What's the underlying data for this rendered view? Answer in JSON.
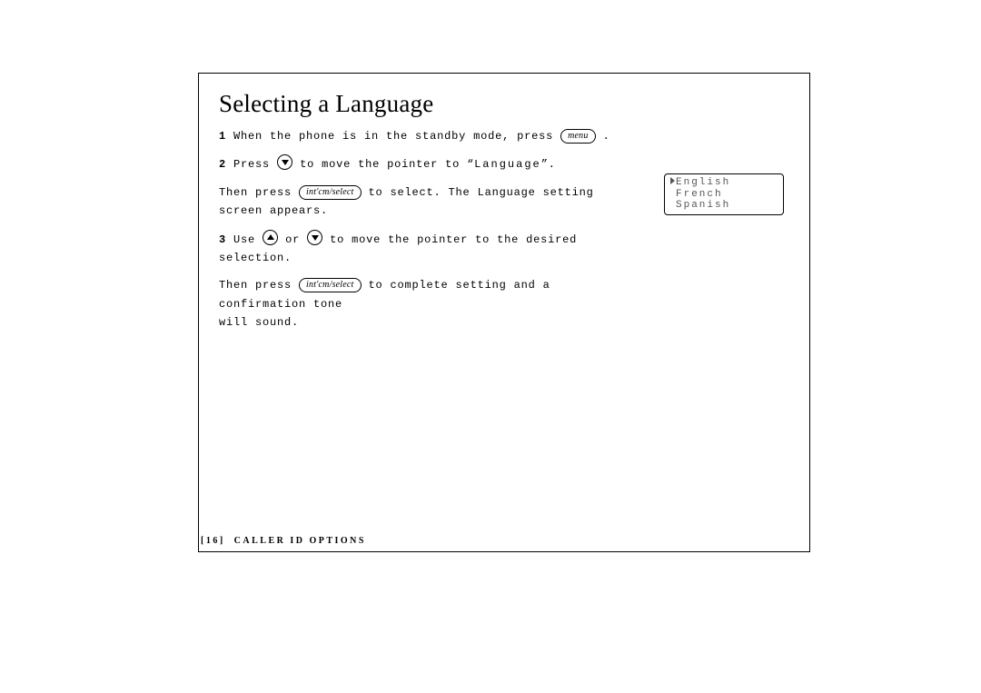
{
  "title": "Selecting a Language",
  "keys": {
    "menu": "menu",
    "select": "int'cm/select"
  },
  "steps": {
    "s1": {
      "num": "1",
      "pre": "When the phone is in the standby mode, press",
      "post": "."
    },
    "s2": {
      "num": "2",
      "pre": "Press",
      "mid": "to move the pointer to “",
      "lcdword": "Language",
      "post": "”."
    },
    "s2b": {
      "pre": "Then press",
      "mid": "to select. The Language setting",
      "post": "screen appears."
    },
    "s3": {
      "num": "3",
      "pre": "Use",
      "mid1": "or",
      "mid2": "to move the pointer to the desired selection."
    },
    "s3b": {
      "pre": "Then press",
      "mid": "to complete setting and a confirmation tone",
      "post": "will sound."
    }
  },
  "lcd": {
    "rows": [
      "English",
      "French",
      "Spanish"
    ]
  },
  "footer": {
    "page": "[16]",
    "section": "CALLER ID OPTIONS"
  }
}
